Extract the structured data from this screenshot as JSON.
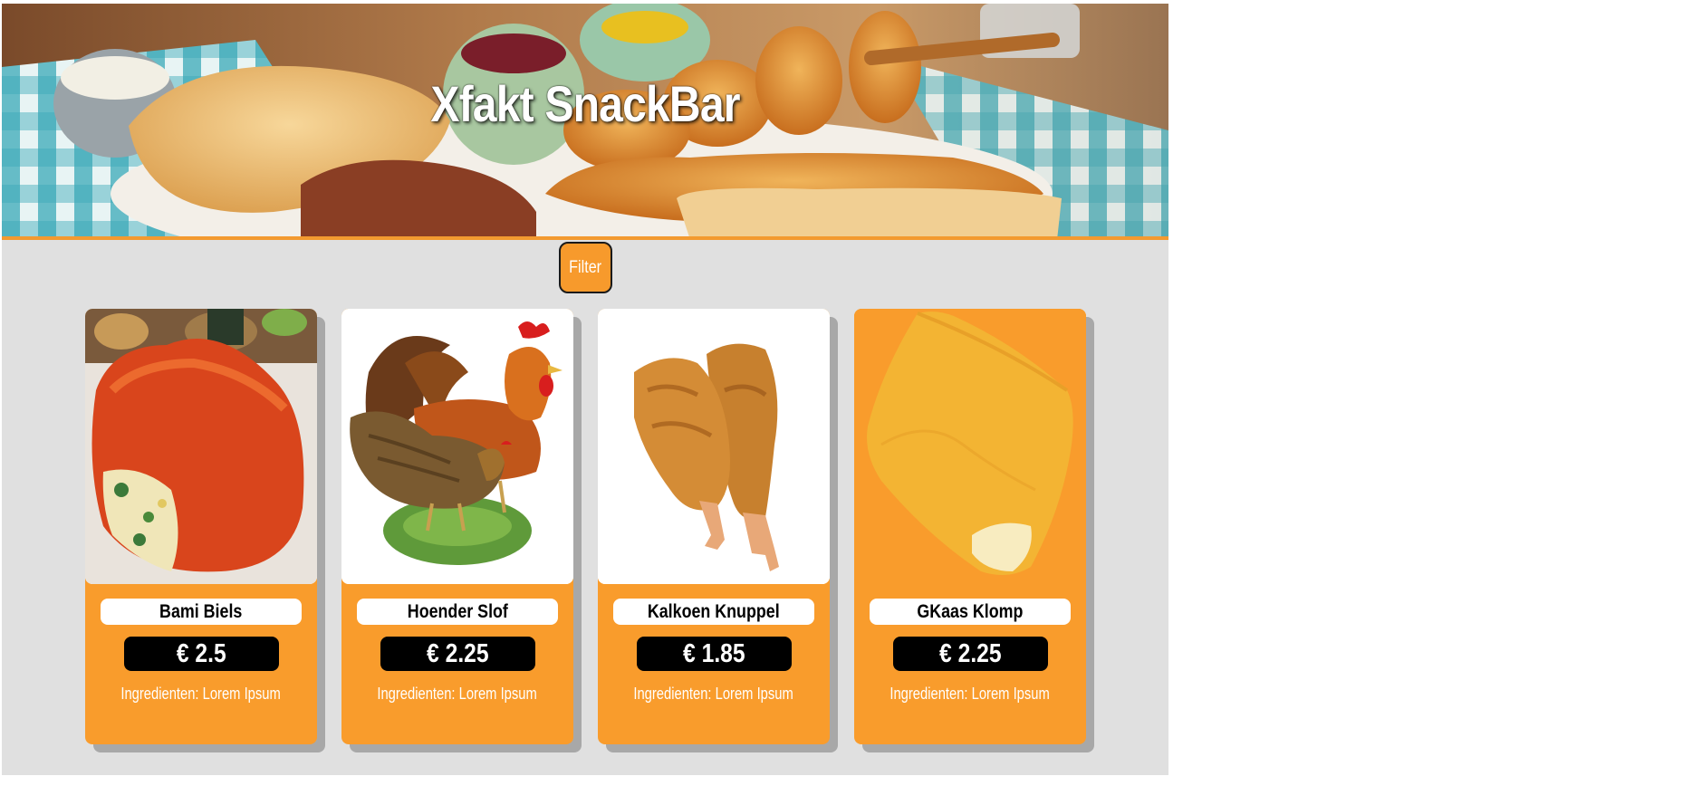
{
  "header": {
    "title": "Xfakt SnackBar"
  },
  "toolbar": {
    "filter_label": "Filter"
  },
  "products": [
    {
      "name": "Bami Biels",
      "price": "€ 2.5",
      "ingredients": "Ingredienten: Lorem Ipsum",
      "image": "bami-icon"
    },
    {
      "name": "Hoender Slof",
      "price": "€ 2.25",
      "ingredients": "Ingredienten: Lorem Ipsum",
      "image": "chicken-icon"
    },
    {
      "name": "Kalkoen Knuppel",
      "price": "€ 1.85",
      "ingredients": "Ingredienten: Lorem Ipsum",
      "image": "drumstick-icon"
    },
    {
      "name": "GKaas Klomp",
      "price": "€ 2.25",
      "ingredients": "Ingredienten: Lorem Ipsum",
      "image": "cheese-snack-icon"
    }
  ],
  "colors": {
    "accent": "#f99c2c",
    "page_background": "#e0e0e0",
    "price_background": "#000000",
    "card_shadow": "#a8a8a8"
  }
}
